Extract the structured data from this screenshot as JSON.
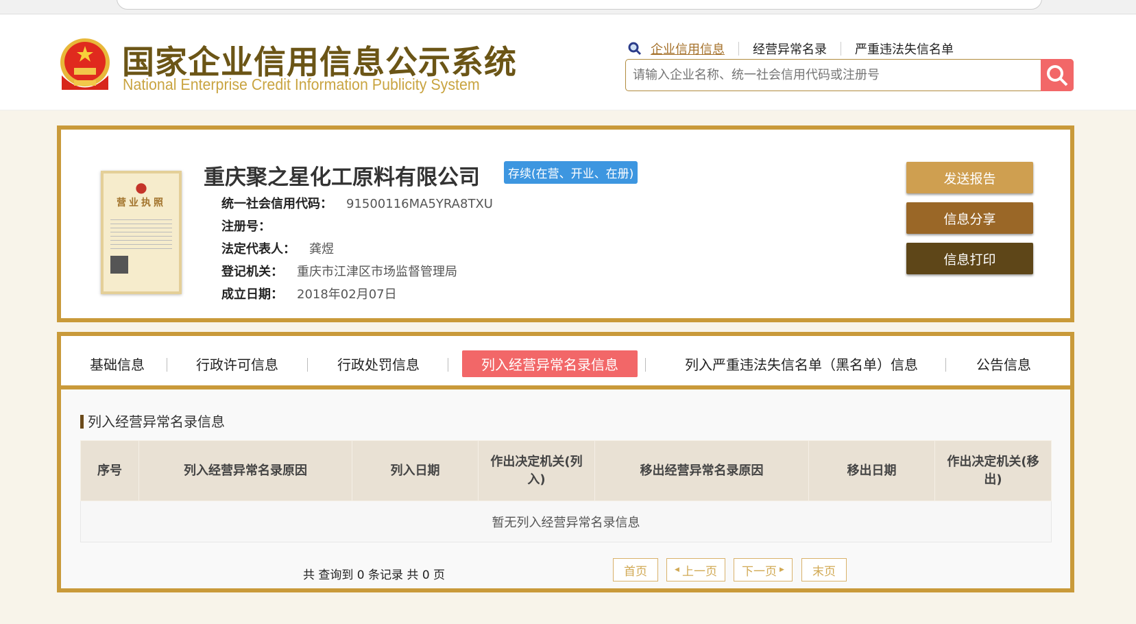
{
  "header": {
    "title_cn": "国家企业信用信息公示系统",
    "title_en": "National Enterprise Credit Information Publicity System",
    "links": [
      "企业信用信息",
      "经营异常名录",
      "严重违法失信名单"
    ],
    "search_placeholder": "请输入企业名称、统一社会信用代码或注册号"
  },
  "company": {
    "name": "重庆聚之星化工原料有限公司",
    "status": "存续(在营、开业、在册)",
    "fields": [
      {
        "label": "统一社会信用代码：",
        "value": "91500116MA5YRA8TXU"
      },
      {
        "label": "注册号：",
        "value": ""
      },
      {
        "label": "法定代表人：",
        "value": "龚煜"
      },
      {
        "label": "登记机关：",
        "value": "重庆市江津区市场监督管理局"
      },
      {
        "label": "成立日期：",
        "value": "2018年02月07日"
      }
    ],
    "license_title": "营业执照",
    "buttons": [
      "发送报告",
      "信息分享",
      "信息打印"
    ]
  },
  "tabs": [
    "基础信息",
    "行政许可信息",
    "行政处罚信息",
    "列入经营异常名录信息",
    "列入严重违法失信名单（黑名单）信息",
    "公告信息"
  ],
  "section": {
    "title": "列入经营异常名录信息",
    "columns": [
      "序号",
      "列入经营异常名录原因",
      "列入日期",
      "作出决定机关(列入)",
      "移出经营异常名录原因",
      "移出日期",
      "作出决定机关(移出)"
    ],
    "empty": "暂无列入经营异常名录信息"
  },
  "pagination": {
    "summary": "共 查询到 0 条记录 共 0 页",
    "first": "首页",
    "prev": "上一页",
    "next": "下一页",
    "last": "末页"
  }
}
